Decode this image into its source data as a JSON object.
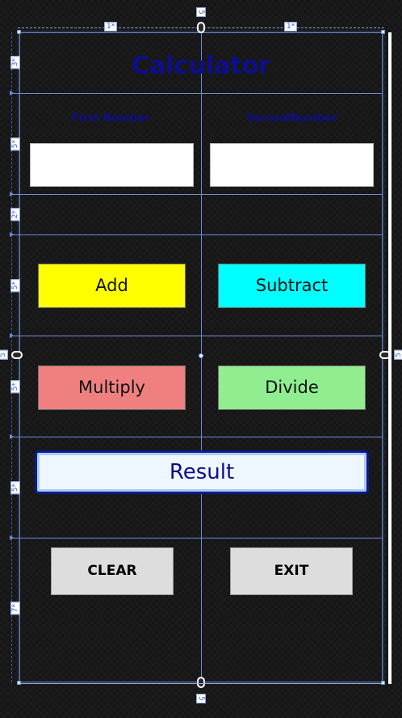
{
  "app": {
    "title": "Calculator"
  },
  "inputs": {
    "first_label": "First Number",
    "second_label": "SecondNumber",
    "first_value": "",
    "second_value": ""
  },
  "operations": {
    "add": "Add",
    "subtract": "Subtract",
    "multiply": "Multiply",
    "divide": "Divide"
  },
  "result": {
    "label": "Result"
  },
  "actions": {
    "clear": "CLEAR",
    "exit": "EXIT"
  },
  "designer": {
    "column_sizes": [
      "1*",
      "1*"
    ],
    "row_sizes": [
      "3*",
      "5*",
      "2*",
      "5*",
      "5*",
      "5*",
      "7*"
    ],
    "margin_top": "5",
    "margin_bottom": "5",
    "margin_left": "5",
    "margin_right": "5"
  },
  "colors": {
    "title": "#0d0d8f",
    "add": "#ffff00",
    "subtract": "#00ffff",
    "multiply": "#f08080",
    "divide": "#90ee90",
    "result_bg": "#eef6ff",
    "result_border": "#0d1a8c",
    "action_bg": "#dddddd",
    "guide": "#6b8fd6"
  }
}
